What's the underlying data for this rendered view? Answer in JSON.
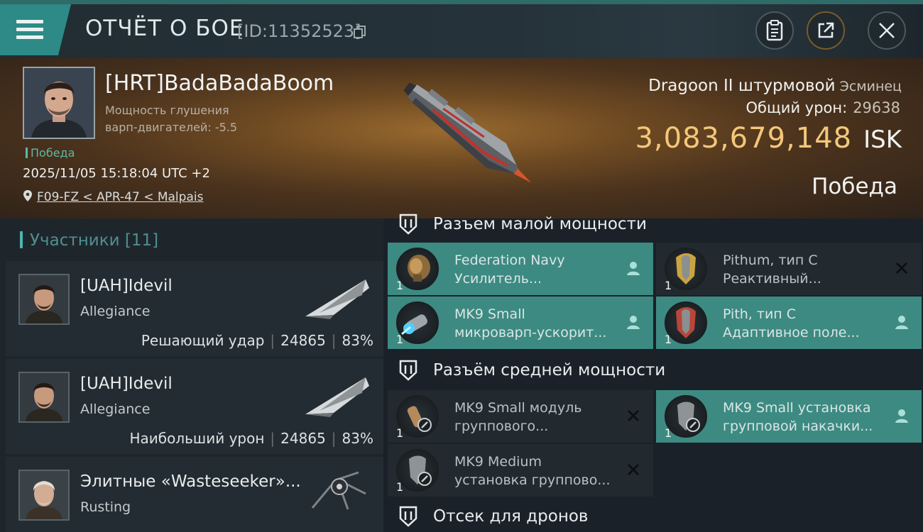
{
  "header": {
    "title": "ОТЧЁТ О БОЕ",
    "report_id": "[ID:11352523]",
    "icons": [
      "menu-icon",
      "copy-icon",
      "clipboard-icon",
      "share-icon",
      "close-icon"
    ]
  },
  "victim": {
    "name": "[HRT]BadaBadaBoom",
    "stat_line1": "Мощность глушения",
    "stat_line2": "варп-двигателей: -5.5",
    "result_tag": "Победа",
    "timestamp": "2025/11/05 15:18:04 UTC +2",
    "location": "F09-FZ < APR-47 < Malpais",
    "ship_name": "Dragoon II штурмовой",
    "ship_class": "Эсминец",
    "damage_label": "Общий урон:",
    "damage_value": "29638",
    "isk_value": "3,083,679,148",
    "isk_unit": "ISK",
    "result": "Победа"
  },
  "participants": {
    "header": "Участники [11]",
    "items": [
      {
        "name": "[UAH]Idevil",
        "corp": "Allegiance",
        "role": "Решающий удар",
        "damage": "24865",
        "percent": "83%"
      },
      {
        "name": "[UAH]Idevil",
        "corp": "Allegiance",
        "role": "Наибольший урон",
        "damage": "24865",
        "percent": "83%"
      },
      {
        "name": "Элитные «Wasteseeker»...",
        "corp": "Rusting",
        "role": "",
        "damage": "",
        "percent": ""
      }
    ]
  },
  "slots": {
    "low": {
      "title": "Разъем малой мощности",
      "modules": [
        {
          "qty": "1",
          "line1": "Federation Navy",
          "line2": "Усилитель...",
          "action": "person-icon"
        },
        {
          "qty": "1",
          "line1": "Pithum, тип C",
          "line2": "Реактивный...",
          "action": "close-icon"
        },
        {
          "qty": "1",
          "line1": "MK9 Small",
          "line2": "микроварп-ускорит...",
          "action": "person-icon"
        },
        {
          "qty": "1",
          "line1": "Pith, тип C",
          "line2": "Адаптивное поле...",
          "action": "person-icon"
        }
      ]
    },
    "mid": {
      "title": "Разъём средней мощности",
      "modules": [
        {
          "qty": "1",
          "line1": "MK9 Small модуль",
          "line2": "группового...",
          "action": "close-icon"
        },
        {
          "qty": "1",
          "line1": "MK9 Small установка",
          "line2": "групповой накачки...",
          "action": "person-icon"
        },
        {
          "qty": "1",
          "line1": "MK9 Medium",
          "line2": "установка группово...",
          "action": "close-icon"
        }
      ]
    },
    "drones": {
      "title": "Отсек для дронов"
    }
  }
}
